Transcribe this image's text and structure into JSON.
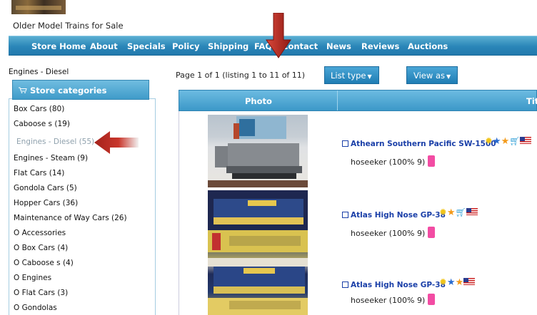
{
  "site": {
    "title": "Older Model Trains for Sale"
  },
  "nav": [
    "Store Home",
    "About",
    "Specials",
    "Policy",
    "Shipping",
    "FAQ",
    "Contact",
    "News",
    "Reviews",
    "Auctions"
  ],
  "breadcrumb": "Engines - Diesel",
  "sidebar": {
    "header": "Store categories",
    "items": [
      "Box Cars (80)",
      "Caboose s (19)",
      "Engines - Diesel (55)",
      "Engines - Steam (9)",
      "Flat Cars (14)",
      "Gondola Cars (5)",
      "Hopper Cars (36)",
      "Maintenance of Way Cars (26)",
      "O Accessories",
      "O Box Cars (4)",
      "O Caboose s (4)",
      "O Engines",
      "O Flat Cars (3)",
      "O Gondolas"
    ],
    "active_index": 2
  },
  "pager": {
    "text": "Page 1 of 1 (listing 1 to 11 of 11)"
  },
  "buttons": {
    "list_type": "List type",
    "view_as": "View as"
  },
  "table": {
    "col_photo": "Photo",
    "col_title": "Titl"
  },
  "listings": [
    {
      "title": "Athearn Southern Pacific SW-1500",
      "seller": "hoseeker (100% 9)"
    },
    {
      "title": "Atlas High Nose GP-38",
      "seller": "hoseeker (100% 9)"
    },
    {
      "title": "Atlas High Nose GP-38",
      "seller": "hoseeker (100% 9)"
    }
  ],
  "colors": {
    "nav_blue": "#2a86b8",
    "link_blue": "#1a3fa8",
    "arrow_red": "#b5231c"
  },
  "icons": [
    "external-link-icon",
    "sun-badge-icon",
    "blue-star-icon",
    "orange-star-icon",
    "cart-icon",
    "us-flag-icon",
    "phone-icon",
    "down-arrow-annotation",
    "left-arrow-annotation"
  ]
}
